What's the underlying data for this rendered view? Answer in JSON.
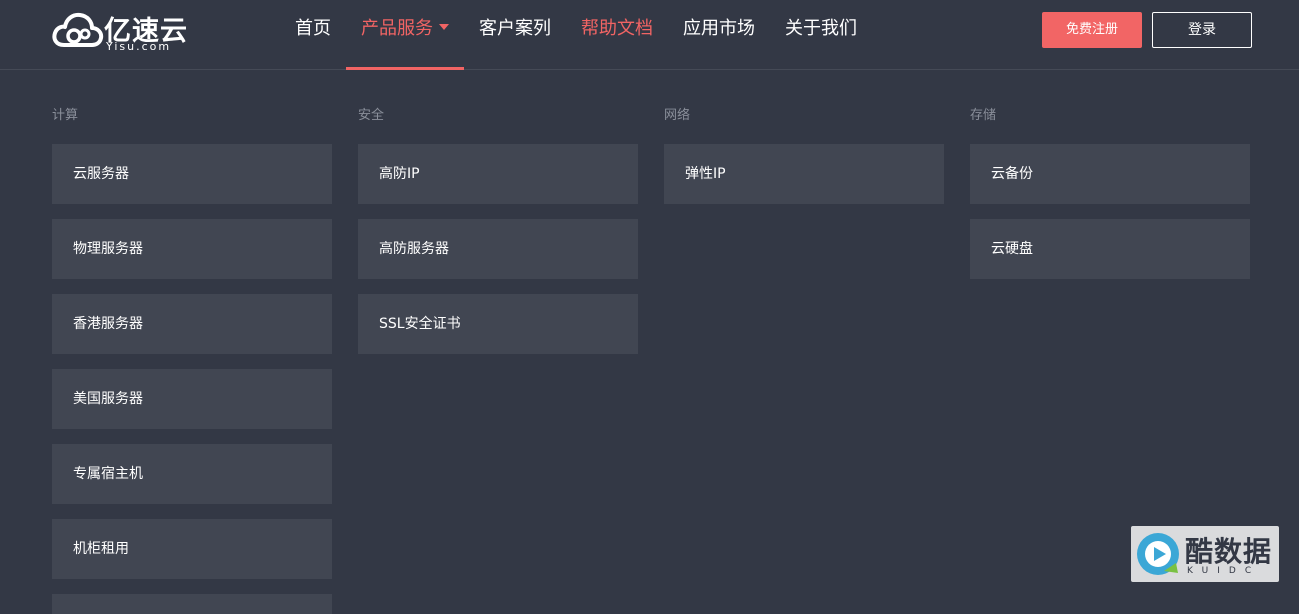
{
  "header": {
    "logo_text": "亿速云",
    "logo_sub": "Yisu.com",
    "nav": [
      {
        "label": "首页"
      },
      {
        "label": "产品服务"
      },
      {
        "label": "客户案列"
      },
      {
        "label": "帮助文档"
      },
      {
        "label": "应用市场"
      },
      {
        "label": "关于我们"
      }
    ],
    "register_label": "免费注册",
    "login_label": "登录"
  },
  "menu": {
    "columns": [
      {
        "title": "计算",
        "items": [
          "云服务器",
          "物理服务器",
          "香港服务器",
          "美国服务器",
          "专属宿主机",
          "机柜租用"
        ]
      },
      {
        "title": "安全",
        "items": [
          "高防IP",
          "高防服务器",
          "SSL安全证书"
        ]
      },
      {
        "title": "网络",
        "items": [
          "弹性IP"
        ]
      },
      {
        "title": "存储",
        "items": [
          "云备份",
          "云硬盘"
        ]
      }
    ]
  },
  "watermark": {
    "text": "酷数据",
    "sub": "KUIDC"
  },
  "colors": {
    "background": "#333845",
    "card": "#414652",
    "accent": "#f26565"
  }
}
